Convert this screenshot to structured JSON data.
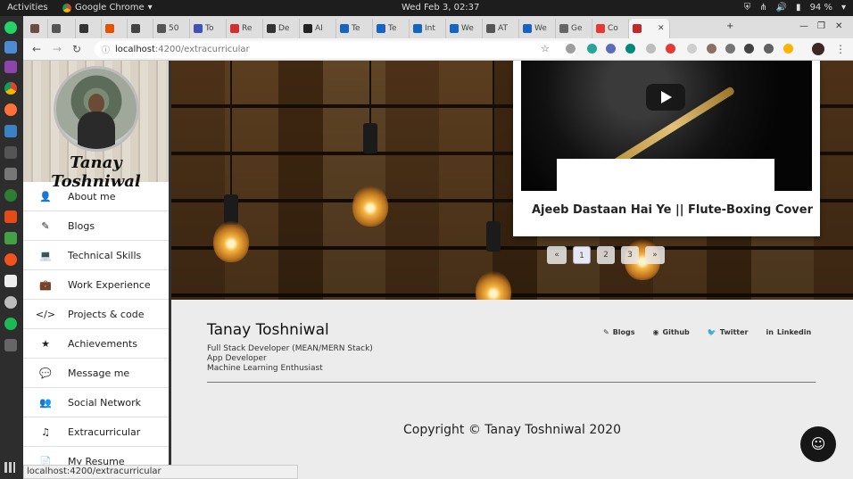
{
  "os_bar": {
    "activities": "Activities",
    "app_name": "Google Chrome",
    "clock": "Wed Feb 3, 02:37",
    "battery": "94 %"
  },
  "tabs": [
    {
      "label": "",
      "color": "#6d4c41"
    },
    {
      "label": "",
      "color": "#555555"
    },
    {
      "label": "",
      "color": "#333333"
    },
    {
      "label": "",
      "color": "#e65100"
    },
    {
      "label": "",
      "color": "#444444"
    },
    {
      "label": "50",
      "color": "#555555"
    },
    {
      "label": "To",
      "color": "#3f51b5"
    },
    {
      "label": "Re",
      "color": "#d32f2f"
    },
    {
      "label": "De",
      "color": "#333333"
    },
    {
      "label": "AI",
      "color": "#222222"
    },
    {
      "label": "Te",
      "color": "#1565c0"
    },
    {
      "label": "Te",
      "color": "#1565c0"
    },
    {
      "label": "Int",
      "color": "#1565c0"
    },
    {
      "label": "We",
      "color": "#1565c0"
    },
    {
      "label": "AT",
      "color": "#555555"
    },
    {
      "label": "We",
      "color": "#1565c0"
    },
    {
      "label": "Ge",
      "color": "#666666"
    },
    {
      "label": "Co",
      "color": "#e53935"
    },
    {
      "label": "",
      "color": "#c62828"
    }
  ],
  "address": {
    "host": "localhost",
    "path": ":4200/extracurricular"
  },
  "sidebar": {
    "name": "Tanay Toshniwal",
    "items": [
      {
        "label": "About me",
        "icon": "user-icon",
        "glyph": "👤"
      },
      {
        "label": "Blogs",
        "icon": "pencil-icon",
        "glyph": "✎"
      },
      {
        "label": "Technical Skills",
        "icon": "laptop-icon",
        "glyph": "💻"
      },
      {
        "label": "Work Experience",
        "icon": "briefcase-icon",
        "glyph": "💼"
      },
      {
        "label": "Projects & code",
        "icon": "code-icon",
        "glyph": "</>"
      },
      {
        "label": "Achievements",
        "icon": "star-icon",
        "glyph": "★"
      },
      {
        "label": "Message me",
        "icon": "comments-icon",
        "glyph": "💬"
      },
      {
        "label": "Social Network",
        "icon": "users-icon",
        "glyph": "👥"
      },
      {
        "label": "Extracurricular",
        "icon": "music-icon",
        "glyph": "♫"
      },
      {
        "label": "My Resume",
        "icon": "file-icon",
        "glyph": "📄"
      }
    ]
  },
  "card": {
    "title": "Ajeeb Dastaan Hai Ye || Flute-Boxing Cover"
  },
  "pager": {
    "prev": "«",
    "pages": [
      "1",
      "2",
      "3"
    ],
    "next": "»",
    "active": 0
  },
  "footer": {
    "name": "Tanay Toshniwal",
    "lines": [
      "Full Stack Developer (MEAN/MERN Stack)",
      "App Developer",
      "Machine Learning Enthusiast"
    ],
    "links": [
      {
        "label": "Blogs",
        "icon": "pencil-icon",
        "glyph": "✎"
      },
      {
        "label": "Github",
        "icon": "github-icon",
        "glyph": "◉"
      },
      {
        "label": "Twitter",
        "icon": "twitter-icon",
        "glyph": "🐦"
      },
      {
        "label": "Linkedin",
        "icon": "linkedin-icon",
        "glyph": "in"
      }
    ],
    "copyright": "Copyright © Tanay Toshniwal 2020"
  },
  "status_url": "localhost:4200/extracurricular"
}
